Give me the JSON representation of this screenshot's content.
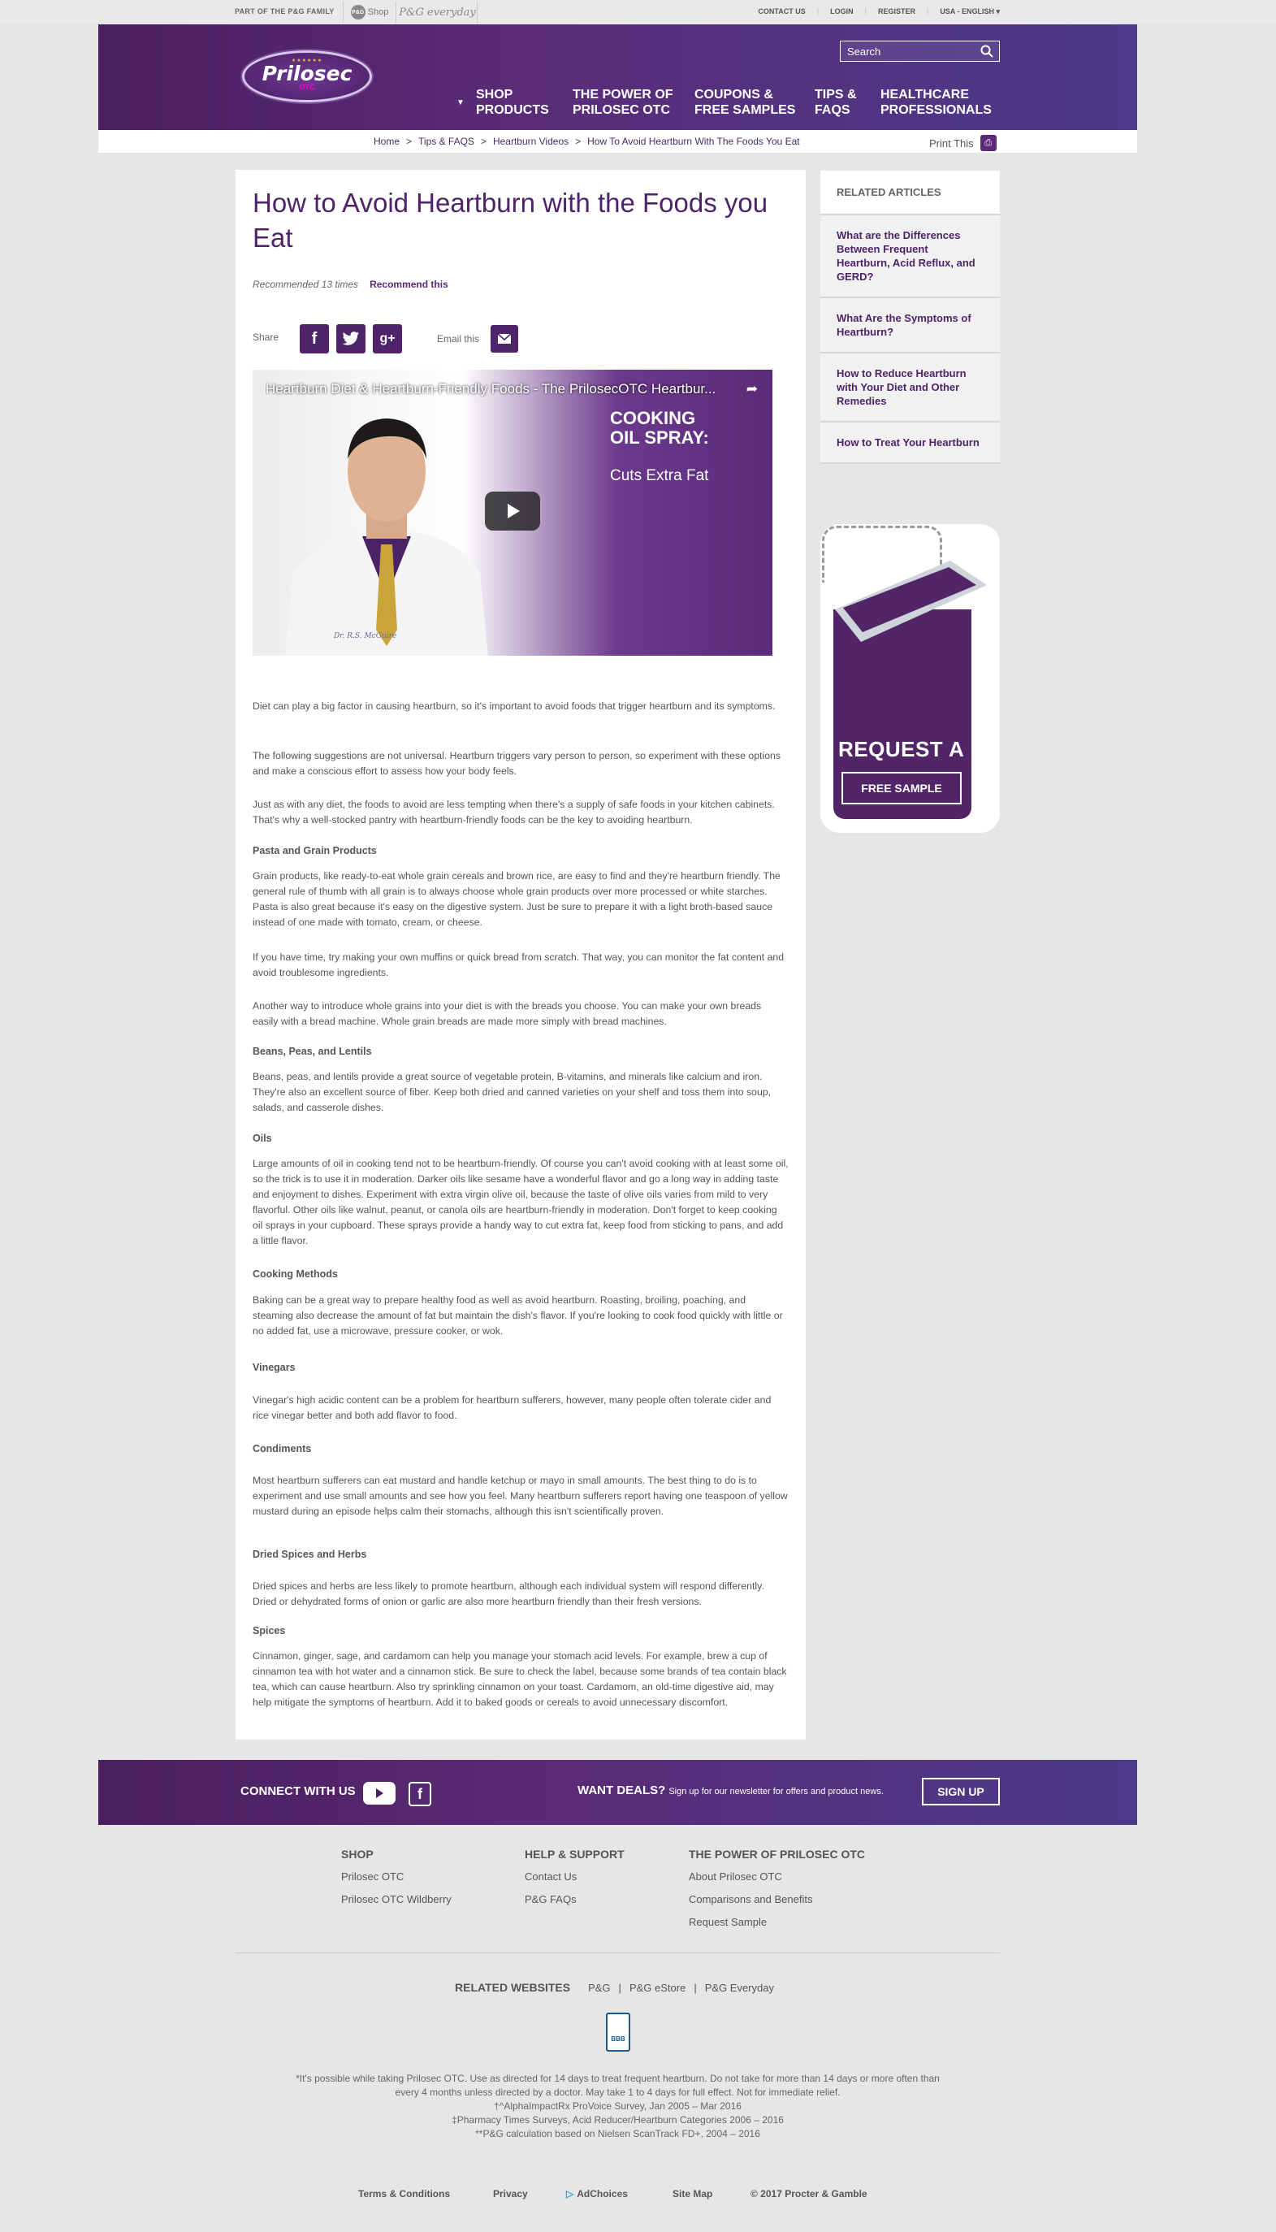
{
  "topbar": {
    "pg_family": "PART OF THE P&G FAMILY",
    "pg_shop": "Shop",
    "pg_shop_badge": "P&G",
    "pg_everyday": "P&G everyday",
    "contact": "CONTACT US",
    "login": "LOGIN",
    "register": "REGISTER",
    "locale": "USA - ENGLISH ▾"
  },
  "header": {
    "logo_name": "Prilosec",
    "logo_sub": "OTC",
    "search_placeholder": "Search",
    "nav": [
      {
        "line1": "SHOP",
        "line2": "PRODUCTS"
      },
      {
        "line1": "THE POWER OF",
        "line2": "PRILOSEC OTC"
      },
      {
        "line1": "COUPONS &",
        "line2": "FREE SAMPLES"
      },
      {
        "line1": "TIPS &",
        "line2": "FAQS"
      },
      {
        "line1": "HEALTHCARE",
        "line2": "PROFESSIONALS"
      }
    ]
  },
  "breadcrumb": {
    "items": [
      "Home",
      "Tips & FAQS",
      "Heartburn Videos",
      "How To Avoid Heartburn With The Foods You Eat"
    ],
    "sep": ">",
    "print": "Print This"
  },
  "article": {
    "title": "How to Avoid Heartburn with the Foods you Eat",
    "recommended": "Recommended 13 times",
    "recommend_link": "Recommend this",
    "share_label": "Share",
    "email_label": "Email this",
    "video_title": "Heartburn Diet & Heartburn-Friendly Foods - The PrilosecOTC Heartbur...",
    "video_cook_line1": "COOKING",
    "video_cook_line2": "OIL SPRAY:",
    "video_cuts": "Cuts Extra Fat",
    "video_signature": "Dr. R.S. McGuire",
    "blocks": [
      {
        "type": "p",
        "text": "Diet can play a big factor in causing heartburn, so it's important to avoid foods that trigger heartburn and its symptoms."
      },
      {
        "type": "p",
        "text": "The following suggestions are not universal. Heartburn triggers vary person to person, so experiment with these options and make a conscious effort to assess how your body feels."
      },
      {
        "type": "p",
        "text": "Just as with any diet, the foods to avoid are less tempting when there's a supply of safe foods in your kitchen cabinets. That's why a well-stocked pantry with heartburn-friendly foods can be the key to avoiding heartburn."
      },
      {
        "type": "h",
        "text": "Pasta and Grain Products"
      },
      {
        "type": "p",
        "text": "Grain products, like ready-to-eat whole grain cereals and brown rice, are easy to find and they're heartburn friendly. The general rule of thumb with all grain is to always choose whole grain products over more processed or white starches. Pasta is also great because it's easy on the digestive system. Just be sure to prepare it with a light broth-based sauce instead of one made with tomato, cream, or cheese."
      },
      {
        "type": "p",
        "text": "If you have time, try making your own muffins or quick bread from scratch. That way, you can monitor the fat content and avoid troublesome ingredients."
      },
      {
        "type": "p",
        "text": "Another way to introduce whole grains into your diet is with the breads you choose. You can make your own breads easily with a bread machine. Whole grain breads are made more simply with bread machines."
      },
      {
        "type": "h",
        "text": "Beans, Peas, and Lentils"
      },
      {
        "type": "p",
        "text": "Beans, peas, and lentils provide a great source of vegetable protein, B-vitamins, and minerals like calcium and iron. They're also an excellent source of fiber. Keep both dried and canned varieties on your shelf and toss them into soup, salads, and casserole dishes."
      },
      {
        "type": "h",
        "text": "Oils"
      },
      {
        "type": "p",
        "text": "Large amounts of oil in cooking tend not to be heartburn-friendly. Of course you can't avoid cooking with at least some oil, so the trick is to use it in moderation. Darker oils like sesame have a wonderful flavor and go a long way in adding taste and enjoyment to dishes. Experiment with extra virgin olive oil, because the taste of olive oils varies from mild to very flavorful. Other oils like walnut, peanut, or canola oils are heartburn-friendly in moderation. Don't forget to keep cooking oil sprays in your cupboard. These sprays provide a handy way to cut extra fat, keep food from sticking to pans, and add a little flavor."
      },
      {
        "type": "h",
        "text": "Cooking Methods"
      },
      {
        "type": "p",
        "text": "Baking can be a great way to prepare healthy food as well as avoid heartburn. Roasting, broiling, poaching, and steaming also decrease the amount of fat but maintain the dish's flavor. If you're looking to cook food quickly with little or no added fat, use a microwave, pressure cooker, or wok."
      },
      {
        "type": "h",
        "text": "Vinegars"
      },
      {
        "type": "p",
        "text": "Vinegar's high acidic content can be a problem for heartburn sufferers, however, many people often tolerate cider and rice vinegar better and both add flavor to food."
      },
      {
        "type": "h",
        "text": "Condiments"
      },
      {
        "type": "p",
        "text": "Most heartburn sufferers can eat mustard and handle ketchup or mayo in small amounts. The best thing to do is to experiment and use small amounts and see how you feel. Many heartburn sufferers report having one teaspoon of yellow mustard during an episode helps calm their stomachs, although this isn't scientifically proven."
      },
      {
        "type": "h",
        "text": "Dried Spices and Herbs"
      },
      {
        "type": "p",
        "text": "Dried spices and herbs are less likely to promote heartburn, although each individual system will respond differently. Dried or dehydrated forms of onion or garlic are also more heartburn friendly than their fresh versions."
      },
      {
        "type": "h",
        "text": "Spices"
      },
      {
        "type": "p",
        "text": "Cinnamon, ginger, sage, and cardamom can help you manage your stomach acid levels. For example, brew a cup of cinnamon tea with hot water and a cinnamon stick. Be sure to check the label, because some brands of tea contain black tea, which can cause heartburn. Also try sprinkling cinnamon on your toast. Cardamom, an old-time digestive aid, may help mitigate the symptoms of heartburn. Add it to baked goods or cereals to avoid unnecessary discomfort."
      }
    ]
  },
  "sidebar": {
    "heading": "RELATED ARTICLES",
    "items": [
      "What are the Differences Between Frequent Heartburn, Acid Reflux, and GERD?",
      "What Are the Symptoms of Heartburn?",
      "How to Reduce Heartburn with Your Diet and Other Remedies",
      "How to Treat Your Heartburn"
    ],
    "promo_title": "REQUEST A",
    "promo_button": "FREE SAMPLE"
  },
  "footer": {
    "connect": "CONNECT WITH US",
    "deals": "WANT DEALS?",
    "deals_sub": "Sign up for our newsletter for offers and product news.",
    "signup": "SIGN UP",
    "columns": [
      {
        "heading": "SHOP",
        "links": [
          "Prilosec OTC",
          "Prilosec OTC Wildberry"
        ]
      },
      {
        "heading": "HELP & SUPPORT",
        "links": [
          "Contact Us",
          "P&G FAQs"
        ]
      },
      {
        "heading": "THE POWER OF PRILOSEC OTC",
        "links": [
          "About Prilosec OTC",
          "Comparisons and Benefits",
          "Request Sample"
        ]
      }
    ],
    "related_heading": "RELATED WEBSITES",
    "related": [
      "P&G",
      "P&G eStore",
      "P&G Everyday"
    ],
    "bbb": "BBB",
    "disclaimers": [
      "*It's possible while taking Prilosec OTC. Use as directed for 14 days to treat frequent heartburn. Do not take for more than 14 days or more often than every 4 months unless directed by a doctor. May take 1 to 4 days for full effect. Not for immediate relief.",
      "†^AlphaImpactRx ProVoice Survey, Jan 2005 – Mar 2016",
      "‡Pharmacy Times Surveys, Acid Reducer/Heartburn Categories 2006 – 2016",
      "**P&G calculation based on Nielsen ScanTrack FD+, 2004 – 2016"
    ],
    "bottom_links": [
      "Terms & Conditions",
      "Privacy",
      "AdChoices",
      "Site Map"
    ],
    "copyright": "© 2017 Procter & Gamble"
  },
  "colors": {
    "brand_purple": "#4f2369",
    "header_gradient_end": "#4b3b8a",
    "page_bg": "#e6e6e6"
  }
}
